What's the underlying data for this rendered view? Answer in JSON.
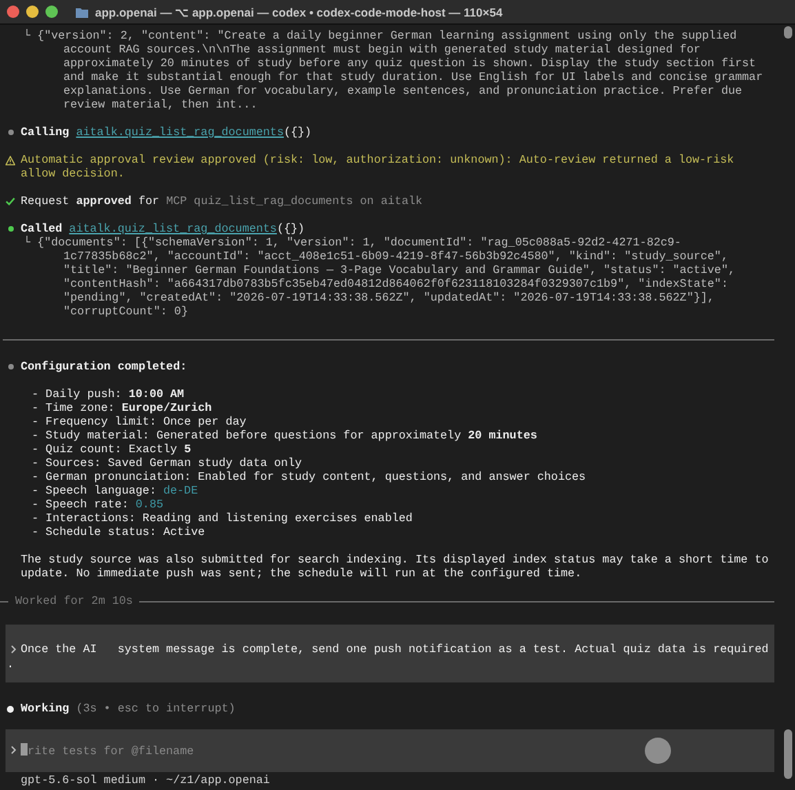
{
  "window": {
    "title": "app.openai — ⌥ app.openai — codex • codex-code-mode-host — 110×54"
  },
  "transcript": [
    {
      "kind": "output",
      "text": "└ {\"version\": 2, \"content\": \"Create a daily beginner German learning assignment using only the supplied account RAG sources.\\n\\nThe assignment must begin with generated study material designed for approximately 20 minutes of study before any quiz question is shown. Display the study section first and make it substantial enough for that study duration. Use English for UI labels and concise grammar explanations. Use German for vocabulary, example sentences, and pronunciation practice. Prefer due review material, then int..."
    },
    {
      "kind": "call",
      "verb": "Calling",
      "tool": "aitalk.quiz_list_rag_documents",
      "args": "({})",
      "done": false
    },
    {
      "kind": "warning",
      "text": "Automatic approval review approved (risk: low, authorization: unknown): Auto-review returned a low-risk allow decision."
    },
    {
      "kind": "approval",
      "text": "Request **approved** for",
      "detail": "MCP quiz_list_rag_documents on aitalk"
    },
    {
      "kind": "call",
      "verb": "Called",
      "tool": "aitalk.quiz_list_rag_documents",
      "args": "({})",
      "done": true
    },
    {
      "kind": "output",
      "text": "└ {\"documents\": [{\"schemaVersion\": 1, \"version\": 1, \"documentId\": \"rag_05c088a5-92d2-4271-82c9-1c77835b68c2\", \"accountId\": \"acct_408e1c51-6b09-4219-8f47-56b3b92c4580\", \"kind\": \"study_source\", \"title\": \"Beginner German Foundations — 3-Page Vocabulary and Grammar Guide\", \"status\": \"active\", \"contentHash\": \"a664317db0783b5fc35eb47ed04812d864062f0f623118103284f0329307c1b9\", \"indexState\": \"pending\", \"createdAt\": \"2026-07-19T14:33:38.562Z\", \"updatedAt\": \"2026-07-19T14:33:38.562Z\"}], \"corruptCount\": 0}"
    },
    {
      "kind": "rule"
    },
    {
      "kind": "summary",
      "title": "Configuration completed:",
      "items": [
        {
          "text": "- Daily push: **10:00 AM**"
        },
        {
          "text": "- Time zone: **Europe/Zurich**"
        },
        {
          "text": "- Frequency limit: Once per day"
        },
        {
          "text": "- Study material: Generated before questions for approximately **20 minutes**"
        },
        {
          "text": "- Quiz count: Exactly **5**"
        },
        {
          "text": "- Sources: Saved German study data only"
        },
        {
          "text": "- German pronunciation: Enabled for study content, questions, and answer choices"
        },
        {
          "text": "- Speech language:",
          "code": "de-DE"
        },
        {
          "text": "- Speech rate:",
          "code": "0.85"
        },
        {
          "text": "- Interactions: Reading and listening exercises enabled"
        },
        {
          "text": "- Schedule status: Active"
        }
      ],
      "note": "The study source was also submitted for search indexing. Its displayed index status may take a short time to update. No immediate push was sent; the schedule will run at the configured time."
    },
    {
      "kind": "worked",
      "text": "Worked for 2m 10s"
    },
    {
      "kind": "message",
      "text": "Once the AI   system message is complete, send one push notification as a test. Actual quiz data is required",
      "overflow": "."
    },
    {
      "kind": "working",
      "label": "Working",
      "detail": "(3s • esc to interrupt)"
    }
  ],
  "composer": {
    "placeholder": "rite tests for @filename"
  },
  "status_bar": "gpt-5.6-sol medium · ~/z1/app.openai"
}
